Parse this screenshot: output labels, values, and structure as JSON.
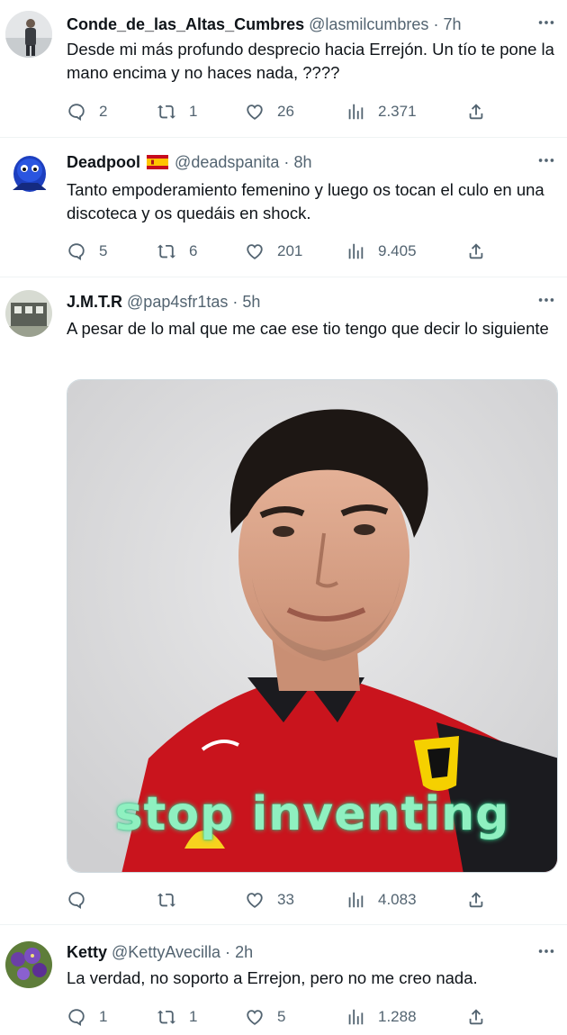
{
  "tweets": [
    {
      "name": "Conde_de_las_Altas_Cumbres",
      "handle": "@lasmilcumbres",
      "sep": "·",
      "time": "7h",
      "text": "Desde mi más profundo desprecio hacia Errejón. Un tío te pone la mano encima y no haces nada, ????",
      "replies": "2",
      "retweets": "1",
      "likes": "26",
      "views": "2.371"
    },
    {
      "name": "Deadpool",
      "handle": "@deadspanita",
      "sep": "·",
      "time": "8h",
      "text": "Tanto empoderamiento femenino y luego os tocan el culo en una discoteca y os quedáis en shock.",
      "replies": "5",
      "retweets": "6",
      "likes": "201",
      "views": "9.405"
    },
    {
      "name": "J.M.T.R",
      "handle": "@pap4sfr1tas",
      "sep": "·",
      "time": "5h",
      "text": "A pesar de lo mal que me cae ese tio tengo que decir lo siguiente",
      "image_caption": "stop inventing",
      "replies": "",
      "retweets": "",
      "likes": "33",
      "views": "4.083"
    },
    {
      "name": "Ketty",
      "handle": "@KettyAvecilla",
      "sep": "·",
      "time": "2h",
      "text": "La verdad, no soporto a Errejon,  pero no me creo nada.",
      "replies": "1",
      "retweets": "1",
      "likes": "5",
      "views": "1.288"
    }
  ],
  "colors": {
    "text": "#0f1419",
    "muted": "#536471",
    "border": "#eff3f4",
    "ferrari_red": "#d0202a",
    "caption_green": "#8ff0c0"
  },
  "icons": [
    "reply-icon",
    "retweet-icon",
    "like-icon",
    "views-icon",
    "share-icon",
    "more-icon",
    "spain-flag-icon"
  ]
}
